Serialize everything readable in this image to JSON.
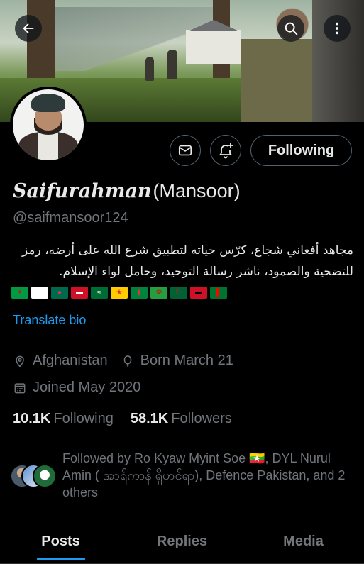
{
  "profile": {
    "name_script": "Saifurahman",
    "name_plain": "(Mansoor)",
    "handle": "@saifmansoor124",
    "bio": "مجاهد أفغاني شجاع، كرّس حياته لتطبيق شرع الله على أرضه، رمز للتضحية والصمود، ناشر رسالة التوحيد، وحامل لواء الإسلام.",
    "translate_label": "Translate bio",
    "location": "Afghanistan",
    "born": "Born March 21",
    "joined": "Joined May 2020"
  },
  "flags": [
    {
      "name": "flag-1",
      "bg": "#009a44",
      "fg": "#e30a17",
      "glyph": "✦"
    },
    {
      "name": "flag-2",
      "bg": "#ffffff",
      "fg": "#ffffff",
      "glyph": "⚐"
    },
    {
      "name": "flag-3",
      "bg": "#006a4e",
      "fg": "#f42a41",
      "glyph": "●"
    },
    {
      "name": "flag-4",
      "bg": "#ce1126",
      "fg": "#ffffff",
      "glyph": "▬"
    },
    {
      "name": "flag-5",
      "bg": "#006c35",
      "fg": "#ffffff",
      "glyph": "≈"
    },
    {
      "name": "flag-6",
      "bg": "#fecb00",
      "fg": "#ea2839",
      "glyph": "★"
    },
    {
      "name": "flag-7",
      "bg": "#00843d",
      "fg": "#e4312b",
      "glyph": "▮"
    },
    {
      "name": "flag-8",
      "bg": "#239f40",
      "fg": "#da0000",
      "glyph": "☫"
    },
    {
      "name": "flag-9",
      "bg": "#006233",
      "fg": "#d21034",
      "glyph": "☪"
    },
    {
      "name": "flag-10",
      "bg": "#ce1126",
      "fg": "#000000",
      "glyph": "▬"
    },
    {
      "name": "flag-11",
      "bg": "#00732f",
      "fg": "#ff0000",
      "glyph": "▌"
    }
  ],
  "counts": {
    "following_value": "10.1K",
    "following_label": "Following",
    "followers_value": "58.1K",
    "followers_label": "Followers"
  },
  "followed_by": "Followed by Ro Kyaw Myint Soe 🇲🇲, DYL Nurul Amin ( အာရ်ကာန် ရှိဟင်ရာ), Defence Pakistan, and 2 others",
  "buttons": {
    "following_label": "Following"
  },
  "tabs": [
    {
      "label": "Posts",
      "active": true
    },
    {
      "label": "Replies",
      "active": false
    },
    {
      "label": "Media",
      "active": false
    }
  ],
  "icons": [
    "back-arrow-icon",
    "search-icon",
    "more-vertical-icon",
    "mail-icon",
    "notification-bell-plus-icon",
    "location-pin-icon",
    "balloon-icon",
    "calendar-icon"
  ],
  "colors": {
    "accent": "#1d9bf0",
    "muted": "#71767b",
    "text": "#e7e9ea",
    "background": "#000000"
  }
}
